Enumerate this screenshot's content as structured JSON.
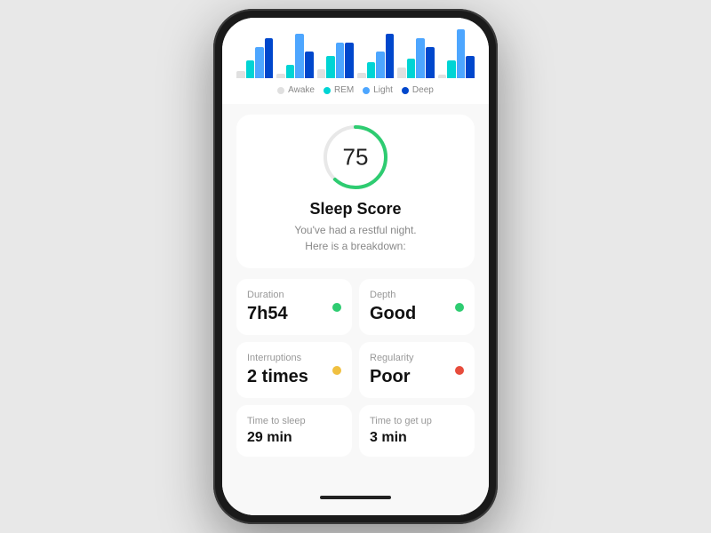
{
  "legend": {
    "awake": "Awake",
    "rem": "REM",
    "light": "Light",
    "deep": "Deep"
  },
  "score": {
    "value": "75",
    "title": "Sleep Score",
    "subtitle_line1": "You've had a restful night.",
    "subtitle_line2": "Here is a breakdown:"
  },
  "metrics": [
    {
      "label": "Duration",
      "value": "7h54",
      "dot_color": "green"
    },
    {
      "label": "Depth",
      "value": "Good",
      "dot_color": "green"
    },
    {
      "label": "Interruptions",
      "value": "2 times",
      "dot_color": "yellow"
    },
    {
      "label": "Regularity",
      "value": "Poor",
      "dot_color": "red"
    }
  ],
  "bottom_metrics": [
    {
      "label": "Time to sleep",
      "value": "29 min"
    },
    {
      "label": "Time to get up",
      "value": "3 min"
    }
  ],
  "chart": {
    "groups": [
      {
        "awake": 8,
        "rem": 20,
        "light": 35,
        "deep": 45
      },
      {
        "awake": 5,
        "rem": 15,
        "light": 50,
        "deep": 30
      },
      {
        "awake": 10,
        "rem": 25,
        "light": 40,
        "deep": 40
      },
      {
        "awake": 6,
        "rem": 18,
        "light": 30,
        "deep": 50
      },
      {
        "awake": 12,
        "rem": 22,
        "light": 45,
        "deep": 35
      },
      {
        "awake": 4,
        "rem": 20,
        "light": 55,
        "deep": 25
      }
    ]
  }
}
